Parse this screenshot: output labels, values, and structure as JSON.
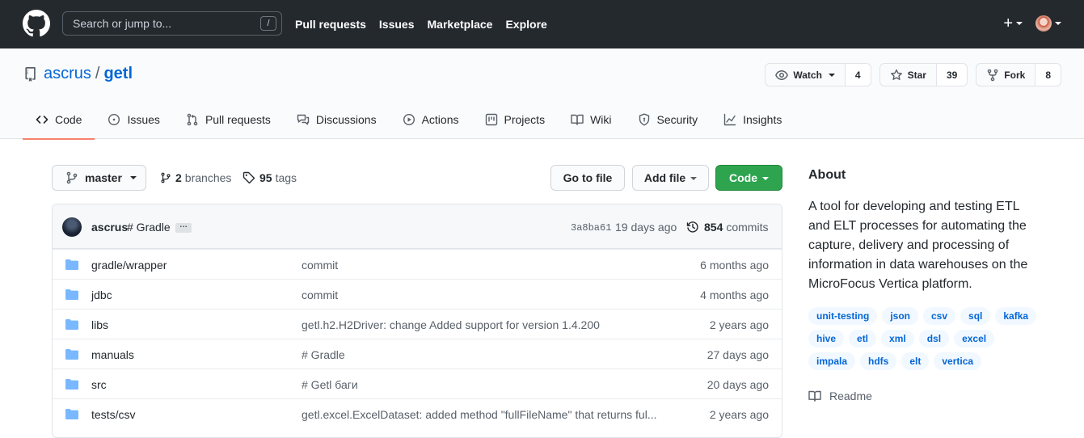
{
  "header": {
    "search_placeholder": "Search or jump to...",
    "search_shortcut": "/",
    "nav": [
      "Pull requests",
      "Issues",
      "Marketplace",
      "Explore"
    ],
    "plus": "+"
  },
  "repo": {
    "owner": "ascrus",
    "separator": "/",
    "name": "getl",
    "watch_label": "Watch",
    "watch_count": "4",
    "star_label": "Star",
    "star_count": "39",
    "fork_label": "Fork",
    "fork_count": "8"
  },
  "tabs": [
    {
      "label": "Code",
      "icon": "code-icon",
      "active": true
    },
    {
      "label": "Issues",
      "icon": "issue-icon"
    },
    {
      "label": "Pull requests",
      "icon": "pull-request-icon"
    },
    {
      "label": "Discussions",
      "icon": "discussion-icon"
    },
    {
      "label": "Actions",
      "icon": "play-icon"
    },
    {
      "label": "Projects",
      "icon": "project-icon"
    },
    {
      "label": "Wiki",
      "icon": "book-icon"
    },
    {
      "label": "Security",
      "icon": "shield-icon"
    },
    {
      "label": "Insights",
      "icon": "graph-icon"
    }
  ],
  "toolbar": {
    "branch": "master",
    "branches_count": "2",
    "branches_label": "branches",
    "tags_count": "95",
    "tags_label": "tags",
    "go_to_file": "Go to file",
    "add_file": "Add file",
    "code": "Code"
  },
  "commit": {
    "author": "ascrus",
    "message": "# Gradle",
    "ellipsis": "…",
    "sha": "3a8ba61",
    "time": "19 days ago",
    "count": "854",
    "count_label": "commits"
  },
  "files": [
    {
      "name": "gradle/wrapper",
      "message": "commit",
      "age": "6 months ago"
    },
    {
      "name": "jdbc",
      "message": "commit",
      "age": "4 months ago"
    },
    {
      "name": "libs",
      "message": "getl.h2.H2Driver: change Added support for version 1.4.200",
      "age": "2 years ago"
    },
    {
      "name": "manuals",
      "message": "# Gradle",
      "age": "27 days ago"
    },
    {
      "name": "src",
      "message": "# Getl баги",
      "age": "20 days ago"
    },
    {
      "name": "tests/csv",
      "message": "getl.excel.ExcelDataset: added method \"fullFileName\" that returns ful...",
      "age": "2 years ago"
    }
  ],
  "about": {
    "title": "About",
    "description": "A tool for developing and testing ETL and ELT processes for automating the capture, delivery and processing of information in data warehouses on the MicroFocus Vertica platform.",
    "topics": [
      "unit-testing",
      "json",
      "csv",
      "sql",
      "kafka",
      "hive",
      "etl",
      "xml",
      "dsl",
      "excel",
      "impala",
      "hdfs",
      "elt",
      "vertica"
    ],
    "readme": "Readme"
  },
  "colors": {
    "header_bg": "#24292e",
    "link": "#0366d6",
    "code_button": "#2ea44f",
    "active_tab_underline": "#f9826c",
    "folder": "#79b8ff"
  }
}
